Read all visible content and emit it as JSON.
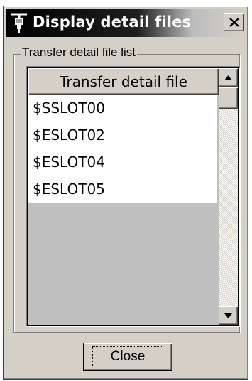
{
  "window": {
    "title": "Display detail files",
    "close_glyph": "✕",
    "title_icon": "plug-icon"
  },
  "group": {
    "label": "Transfer detail file list"
  },
  "list": {
    "header": "Transfer detail file",
    "items": [
      {
        "label": "$SSLOT00"
      },
      {
        "label": "$ESLOT02"
      },
      {
        "label": "$ESLOT04"
      },
      {
        "label": "$ESLOT05"
      }
    ]
  },
  "buttons": {
    "close_label": "Close"
  },
  "colors": {
    "face": "#d4d0c8",
    "list_bg": "#c0c0c0",
    "title_start": "#000000"
  }
}
